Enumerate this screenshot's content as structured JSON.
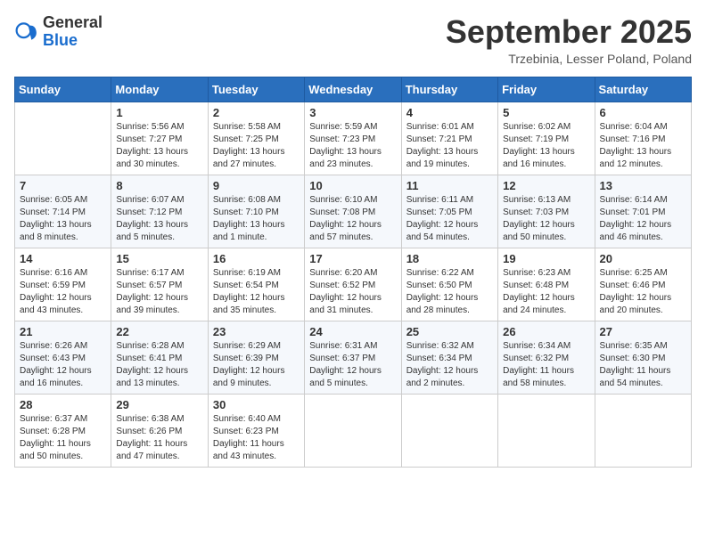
{
  "header": {
    "logo": {
      "general": "General",
      "blue": "Blue"
    },
    "title": "September 2025",
    "location": "Trzebinia, Lesser Poland, Poland"
  },
  "calendar": {
    "headers": [
      "Sunday",
      "Monday",
      "Tuesday",
      "Wednesday",
      "Thursday",
      "Friday",
      "Saturday"
    ],
    "weeks": [
      [
        {
          "day": "",
          "info": ""
        },
        {
          "day": "1",
          "info": "Sunrise: 5:56 AM\nSunset: 7:27 PM\nDaylight: 13 hours\nand 30 minutes."
        },
        {
          "day": "2",
          "info": "Sunrise: 5:58 AM\nSunset: 7:25 PM\nDaylight: 13 hours\nand 27 minutes."
        },
        {
          "day": "3",
          "info": "Sunrise: 5:59 AM\nSunset: 7:23 PM\nDaylight: 13 hours\nand 23 minutes."
        },
        {
          "day": "4",
          "info": "Sunrise: 6:01 AM\nSunset: 7:21 PM\nDaylight: 13 hours\nand 19 minutes."
        },
        {
          "day": "5",
          "info": "Sunrise: 6:02 AM\nSunset: 7:19 PM\nDaylight: 13 hours\nand 16 minutes."
        },
        {
          "day": "6",
          "info": "Sunrise: 6:04 AM\nSunset: 7:16 PM\nDaylight: 13 hours\nand 12 minutes."
        }
      ],
      [
        {
          "day": "7",
          "info": "Sunrise: 6:05 AM\nSunset: 7:14 PM\nDaylight: 13 hours\nand 8 minutes."
        },
        {
          "day": "8",
          "info": "Sunrise: 6:07 AM\nSunset: 7:12 PM\nDaylight: 13 hours\nand 5 minutes."
        },
        {
          "day": "9",
          "info": "Sunrise: 6:08 AM\nSunset: 7:10 PM\nDaylight: 13 hours\nand 1 minute."
        },
        {
          "day": "10",
          "info": "Sunrise: 6:10 AM\nSunset: 7:08 PM\nDaylight: 12 hours\nand 57 minutes."
        },
        {
          "day": "11",
          "info": "Sunrise: 6:11 AM\nSunset: 7:05 PM\nDaylight: 12 hours\nand 54 minutes."
        },
        {
          "day": "12",
          "info": "Sunrise: 6:13 AM\nSunset: 7:03 PM\nDaylight: 12 hours\nand 50 minutes."
        },
        {
          "day": "13",
          "info": "Sunrise: 6:14 AM\nSunset: 7:01 PM\nDaylight: 12 hours\nand 46 minutes."
        }
      ],
      [
        {
          "day": "14",
          "info": "Sunrise: 6:16 AM\nSunset: 6:59 PM\nDaylight: 12 hours\nand 43 minutes."
        },
        {
          "day": "15",
          "info": "Sunrise: 6:17 AM\nSunset: 6:57 PM\nDaylight: 12 hours\nand 39 minutes."
        },
        {
          "day": "16",
          "info": "Sunrise: 6:19 AM\nSunset: 6:54 PM\nDaylight: 12 hours\nand 35 minutes."
        },
        {
          "day": "17",
          "info": "Sunrise: 6:20 AM\nSunset: 6:52 PM\nDaylight: 12 hours\nand 31 minutes."
        },
        {
          "day": "18",
          "info": "Sunrise: 6:22 AM\nSunset: 6:50 PM\nDaylight: 12 hours\nand 28 minutes."
        },
        {
          "day": "19",
          "info": "Sunrise: 6:23 AM\nSunset: 6:48 PM\nDaylight: 12 hours\nand 24 minutes."
        },
        {
          "day": "20",
          "info": "Sunrise: 6:25 AM\nSunset: 6:46 PM\nDaylight: 12 hours\nand 20 minutes."
        }
      ],
      [
        {
          "day": "21",
          "info": "Sunrise: 6:26 AM\nSunset: 6:43 PM\nDaylight: 12 hours\nand 16 minutes."
        },
        {
          "day": "22",
          "info": "Sunrise: 6:28 AM\nSunset: 6:41 PM\nDaylight: 12 hours\nand 13 minutes."
        },
        {
          "day": "23",
          "info": "Sunrise: 6:29 AM\nSunset: 6:39 PM\nDaylight: 12 hours\nand 9 minutes."
        },
        {
          "day": "24",
          "info": "Sunrise: 6:31 AM\nSunset: 6:37 PM\nDaylight: 12 hours\nand 5 minutes."
        },
        {
          "day": "25",
          "info": "Sunrise: 6:32 AM\nSunset: 6:34 PM\nDaylight: 12 hours\nand 2 minutes."
        },
        {
          "day": "26",
          "info": "Sunrise: 6:34 AM\nSunset: 6:32 PM\nDaylight: 11 hours\nand 58 minutes."
        },
        {
          "day": "27",
          "info": "Sunrise: 6:35 AM\nSunset: 6:30 PM\nDaylight: 11 hours\nand 54 minutes."
        }
      ],
      [
        {
          "day": "28",
          "info": "Sunrise: 6:37 AM\nSunset: 6:28 PM\nDaylight: 11 hours\nand 50 minutes."
        },
        {
          "day": "29",
          "info": "Sunrise: 6:38 AM\nSunset: 6:26 PM\nDaylight: 11 hours\nand 47 minutes."
        },
        {
          "day": "30",
          "info": "Sunrise: 6:40 AM\nSunset: 6:23 PM\nDaylight: 11 hours\nand 43 minutes."
        },
        {
          "day": "",
          "info": ""
        },
        {
          "day": "",
          "info": ""
        },
        {
          "day": "",
          "info": ""
        },
        {
          "day": "",
          "info": ""
        }
      ]
    ]
  }
}
